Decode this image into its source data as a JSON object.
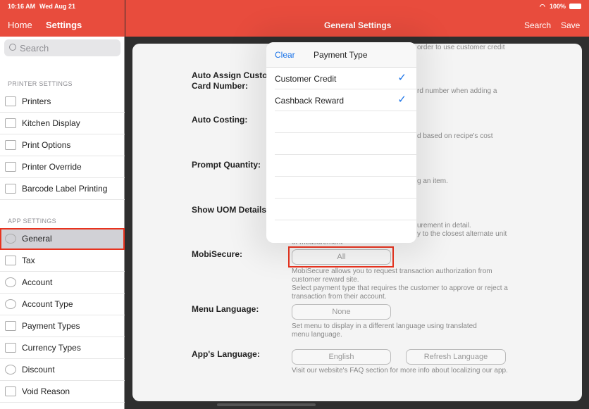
{
  "status": {
    "time": "10:16 AM",
    "date": "Wed Aug 21",
    "battery": "100%"
  },
  "nav": {
    "home": "Home",
    "settings": "Settings",
    "title": "General Settings",
    "search": "Search",
    "save": "Save"
  },
  "sidebar": {
    "search_placeholder": "Search",
    "printer_section": "PRINTER SETTINGS",
    "printer_items": [
      {
        "label": "Printers",
        "icon": "printer-icon"
      },
      {
        "label": "Kitchen Display",
        "icon": "kitchen-display-icon"
      },
      {
        "label": "Print Options",
        "icon": "print-options-icon"
      },
      {
        "label": "Printer Override",
        "icon": "document-icon"
      },
      {
        "label": "Barcode Label Printing",
        "icon": "barcode-icon"
      }
    ],
    "app_section": "APP SETTINGS",
    "app_items": [
      {
        "label": "General",
        "icon": "gear-icon",
        "selected": true
      },
      {
        "label": "Tax",
        "icon": "tax-icon"
      },
      {
        "label": "Account",
        "icon": "person-icon"
      },
      {
        "label": "Account Type",
        "icon": "account-type-icon"
      },
      {
        "label": "Payment Types",
        "icon": "payment-icon"
      },
      {
        "label": "Currency Types",
        "icon": "currency-icon"
      },
      {
        "label": "Discount",
        "icon": "percent-icon"
      },
      {
        "label": "Void Reason",
        "icon": "void-icon"
      }
    ]
  },
  "settings": {
    "auto_assign": {
      "label1": "Auto Assign Custo",
      "label2": "Card Number:",
      "desc_top": "order to use customer credit",
      "desc": "rd number when adding a"
    },
    "auto_costing": {
      "label": "Auto Costing:",
      "desc": "d based on recipe's cost"
    },
    "prompt_quantity": {
      "label": "Prompt Quantity:",
      "desc": "g an item."
    },
    "show_uom": {
      "label": "Show UOM Details",
      "desc1": "urement in detail.",
      "desc2": "y to the closest alternate unit",
      "desc3": "of measurement"
    },
    "mobisecure": {
      "label": "MobiSecure:",
      "value": "All",
      "desc1": "MobiSecure allows you to request transaction authorization from",
      "desc2": "customer reward site.",
      "desc3": "Select payment type that requires the customer to approve or reject a",
      "desc4": "transaction from their account."
    },
    "menu_language": {
      "label": "Menu Language:",
      "value": "None",
      "desc1": "Set menu to display in a different language using translated",
      "desc2": "menu language."
    },
    "app_language": {
      "label": "App's Language:",
      "value": "English",
      "refresh": "Refresh Language",
      "desc": "Visit our website's FAQ section for more info about localizing our app."
    }
  },
  "popover": {
    "clear": "Clear",
    "title": "Payment Type",
    "options": [
      {
        "label": "Customer Credit",
        "checked": true
      },
      {
        "label": "Cashback Reward",
        "checked": true
      }
    ],
    "accent": "#1a73e8"
  }
}
